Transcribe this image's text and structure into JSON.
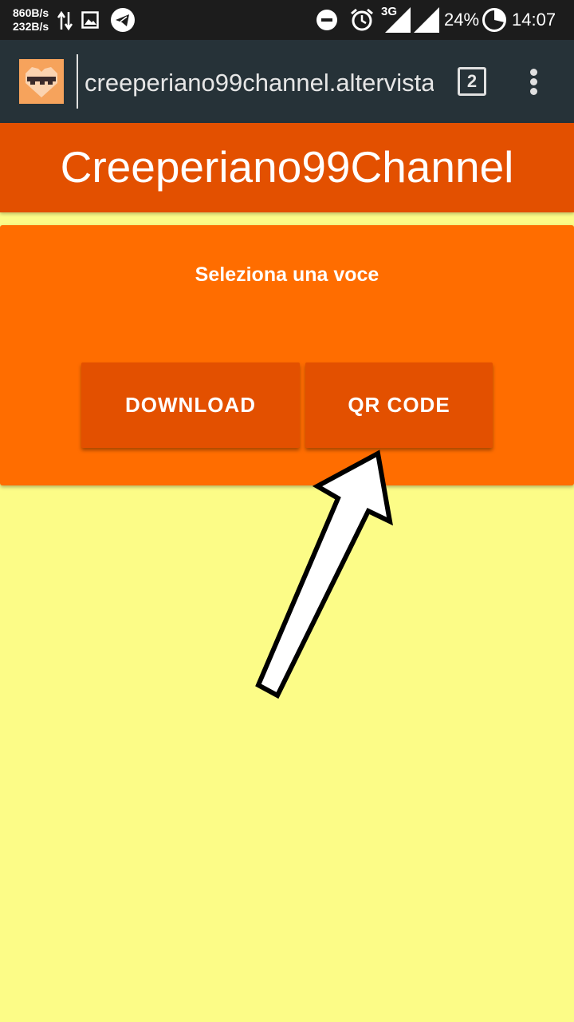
{
  "status_bar": {
    "net_down": "860B/s",
    "net_up": "232B/s",
    "network_type": "3G",
    "battery": "24%",
    "time": "14:07",
    "icons": [
      "transfer-arrows-icon",
      "image-icon",
      "telegram-icon",
      "do-not-disturb-icon",
      "alarm-icon",
      "signal-icon",
      "battery-icon"
    ]
  },
  "browser": {
    "url": "creeperiano99channel.altervista",
    "tab_count": "2",
    "menu_icon": "overflow-menu-icon"
  },
  "page": {
    "title": "Creeperiano99Channel",
    "prompt": "Seleziona una voce",
    "buttons": {
      "download": "DOWNLOAD",
      "qr_code": "QR CODE"
    }
  },
  "colors": {
    "status_bar": "#1c1c1c",
    "toolbar": "#263238",
    "header": "#e35000",
    "card": "#ff6d00",
    "button": "#e35000",
    "page_background": "#fcfc87"
  }
}
